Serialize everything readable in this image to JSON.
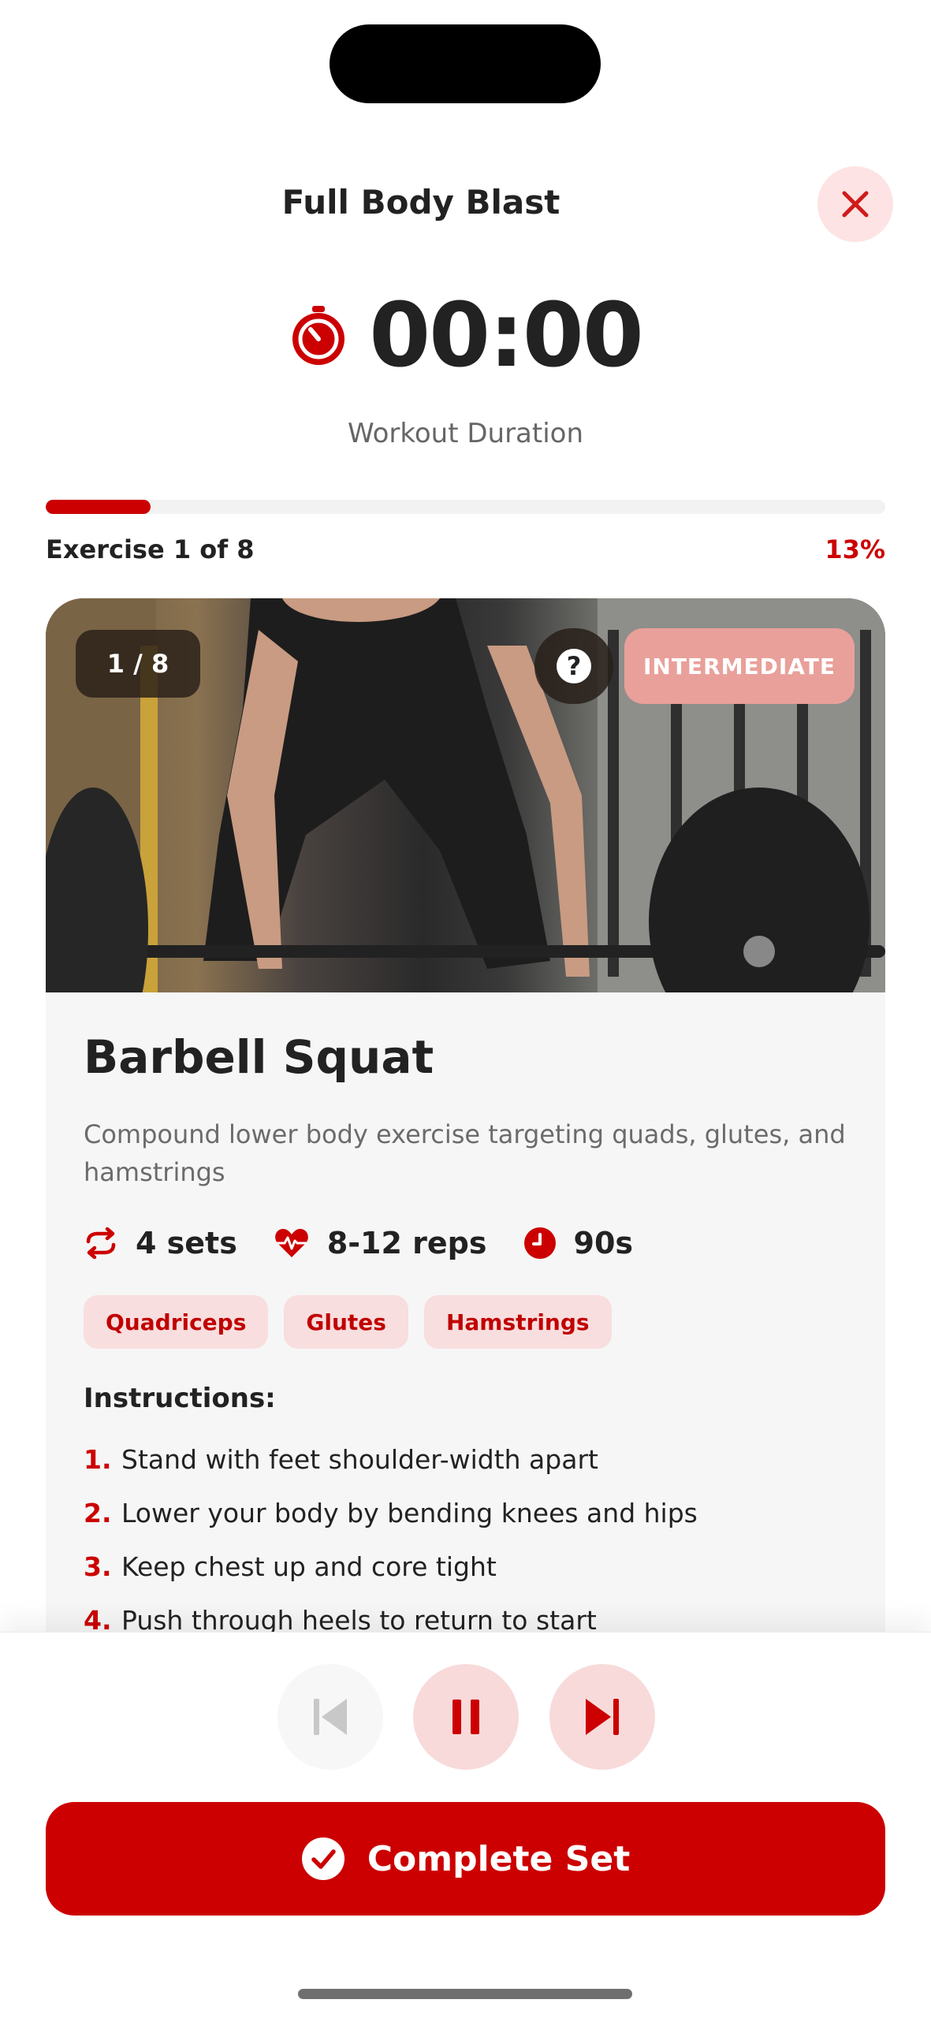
{
  "header": {
    "title": "Full Body Blast"
  },
  "timer": {
    "value": "00:00",
    "caption": "Workout Duration"
  },
  "progress": {
    "label": "Exercise 1 of 8",
    "percent_label": "13%",
    "fraction": 0.125
  },
  "exercise": {
    "counter": "1 / 8",
    "help_label": "?",
    "level": "INTERMEDIATE",
    "name": "Barbell Squat",
    "description": "Compound lower body exercise targeting quads, glutes, and hamstrings",
    "stats": {
      "sets": "4 sets",
      "reps": "8-12 reps",
      "rest": "90s"
    },
    "muscles": [
      "Quadriceps",
      "Glutes",
      "Hamstrings"
    ],
    "instructions_title": "Instructions:",
    "instructions": [
      {
        "num": "1.",
        "text": "Stand with feet shoulder-width apart"
      },
      {
        "num": "2.",
        "text": "Lower your body by bending knees and hips"
      },
      {
        "num": "3.",
        "text": "Keep chest up and core tight"
      },
      {
        "num": "4.",
        "text": "Push through heels to return to start"
      }
    ]
  },
  "controls": {
    "complete_label": "Complete Set"
  },
  "colors": {
    "accent": "#cc0000",
    "accent_light": "#f8dada",
    "badge": "#e9a09a"
  },
  "icons": [
    "close-icon",
    "stopwatch-icon",
    "help-icon",
    "repeat-icon",
    "heartbeat-icon",
    "clock-icon",
    "skip-previous-icon",
    "pause-icon",
    "skip-next-icon",
    "check-circle-icon"
  ]
}
